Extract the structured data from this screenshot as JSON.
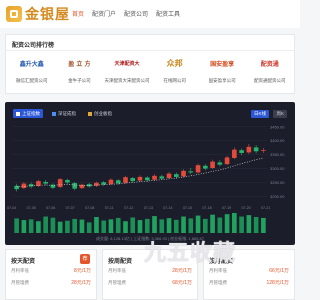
{
  "header": {
    "logo_text": "金银屋",
    "nav": [
      "首页",
      "配资门户",
      "配资公司",
      "配资工具"
    ]
  },
  "section1": {
    "title": "配资公司排行榜",
    "brands": [
      {
        "logo": "鑫升大鑫",
        "name": "融信汇配资公司",
        "color": "#2a5db0"
      },
      {
        "logo": "盈 立 方",
        "name": "金牛子公司",
        "color": "#a0522d"
      },
      {
        "logo": "天津配资大",
        "name": "天津配资大宋配资公司",
        "color": "#b22222"
      },
      {
        "logo": "众邦",
        "name": "在线网公司",
        "color": "#c8871c"
      },
      {
        "logo": "国安盈享",
        "name": "国安盈享公司",
        "color": "#d24a1f"
      },
      {
        "logo": "配资通",
        "name": "配资通配资公司",
        "color": "#d03a2e"
      }
    ]
  },
  "chart": {
    "legend": [
      "上证指数",
      "深证成指",
      "创业板指"
    ],
    "legend_colors": [
      "#2b57d6",
      "#4c8cf5",
      "#e0a63b"
    ],
    "periods": [
      "日K线",
      "周K"
    ],
    "footer": "成交量: 8,128.13亿 | 上证指数: 3,366.93 | 创业板指: 1,869.87",
    "x_labels": [
      "07-04",
      "07-05",
      "07-06",
      "07-07",
      "07-08",
      "07-11",
      "07-12",
      "07-13",
      "07-14",
      "07-15",
      "07-18",
      "07-19",
      "07-20",
      "07-21"
    ],
    "y_labels": [
      "3450.00",
      "3400.00",
      "3350.00",
      "3300.00",
      "3250.00",
      "3200.00"
    ]
  },
  "chart_data": {
    "type": "candlestick",
    "candles": [
      {
        "o": 3238,
        "c": 3226,
        "h": 3245,
        "l": 3218
      },
      {
        "o": 3230,
        "c": 3246,
        "h": 3252,
        "l": 3226
      },
      {
        "o": 3244,
        "c": 3236,
        "h": 3250,
        "l": 3229
      },
      {
        "o": 3238,
        "c": 3255,
        "h": 3260,
        "l": 3234
      },
      {
        "o": 3252,
        "c": 3246,
        "h": 3259,
        "l": 3240
      },
      {
        "o": 3242,
        "c": 3231,
        "h": 3247,
        "l": 3226
      },
      {
        "o": 3234,
        "c": 3262,
        "h": 3266,
        "l": 3230
      },
      {
        "o": 3259,
        "c": 3250,
        "h": 3264,
        "l": 3244
      },
      {
        "o": 3248,
        "c": 3228,
        "h": 3252,
        "l": 3222
      },
      {
        "o": 3230,
        "c": 3242,
        "h": 3246,
        "l": 3226
      },
      {
        "o": 3244,
        "c": 3236,
        "h": 3249,
        "l": 3232
      },
      {
        "o": 3238,
        "c": 3249,
        "h": 3253,
        "l": 3234
      },
      {
        "o": 3251,
        "c": 3243,
        "h": 3255,
        "l": 3238
      },
      {
        "o": 3244,
        "c": 3260,
        "h": 3265,
        "l": 3240
      },
      {
        "o": 3258,
        "c": 3247,
        "h": 3262,
        "l": 3242
      },
      {
        "o": 3249,
        "c": 3269,
        "h": 3274,
        "l": 3245
      },
      {
        "o": 3266,
        "c": 3255,
        "h": 3270,
        "l": 3250
      },
      {
        "o": 3257,
        "c": 3270,
        "h": 3276,
        "l": 3253
      },
      {
        "o": 3268,
        "c": 3258,
        "h": 3272,
        "l": 3252
      },
      {
        "o": 3260,
        "c": 3274,
        "h": 3280,
        "l": 3256
      },
      {
        "o": 3272,
        "c": 3264,
        "h": 3278,
        "l": 3258
      },
      {
        "o": 3266,
        "c": 3282,
        "h": 3288,
        "l": 3262
      },
      {
        "o": 3280,
        "c": 3270,
        "h": 3286,
        "l": 3264
      },
      {
        "o": 3272,
        "c": 3292,
        "h": 3298,
        "l": 3268
      },
      {
        "o": 3290,
        "c": 3286,
        "h": 3302,
        "l": 3280
      },
      {
        "o": 3286,
        "c": 3312,
        "h": 3318,
        "l": 3282
      },
      {
        "o": 3310,
        "c": 3300,
        "h": 3316,
        "l": 3294
      },
      {
        "o": 3302,
        "c": 3325,
        "h": 3332,
        "l": 3298
      },
      {
        "o": 3322,
        "c": 3314,
        "h": 3330,
        "l": 3308
      },
      {
        "o": 3316,
        "c": 3340,
        "h": 3346,
        "l": 3312
      },
      {
        "o": 3338,
        "c": 3368,
        "h": 3376,
        "l": 3334
      },
      {
        "o": 3366,
        "c": 3356,
        "h": 3372,
        "l": 3348
      },
      {
        "o": 3358,
        "c": 3378,
        "h": 3388,
        "l": 3352
      },
      {
        "o": 3376,
        "c": 3362,
        "h": 3384,
        "l": 3354
      },
      {
        "o": 3364,
        "c": 3366,
        "h": 3374,
        "l": 3356
      }
    ],
    "volumes": [
      62,
      55,
      58,
      50,
      70,
      65,
      48,
      52,
      60,
      57,
      45,
      68,
      53,
      58,
      64,
      50,
      66,
      55,
      60,
      72,
      58,
      63,
      56,
      70,
      62,
      74,
      60,
      78,
      66,
      80,
      85,
      70,
      76,
      68,
      64
    ],
    "ma_line": [
      3235,
      3236,
      3238,
      3240,
      3241,
      3240,
      3242,
      3243,
      3241,
      3240,
      3240,
      3241,
      3242,
      3244,
      3245,
      3248,
      3250,
      3253,
      3255,
      3258,
      3260,
      3263,
      3266,
      3270,
      3274,
      3279,
      3284,
      3290,
      3295,
      3302,
      3310,
      3318,
      3325,
      3332,
      3338
    ],
    "ylim": [
      3180,
      3460
    ],
    "grid": true
  },
  "bottom": {
    "cards": [
      {
        "title": "按天配资",
        "sub": "月利率低",
        "val": "8元/1万",
        "sub2": "月管理费",
        "val2": "28元/1万"
      },
      {
        "title": "按周配资",
        "sub": "月利率低",
        "val": "28元/1万",
        "sub2": "月管理费",
        "val2": "68元/1万"
      },
      {
        "title": "按月配资",
        "sub": "月利率低",
        "val": "66元/1万",
        "sub2": "月管理费",
        "val2": "128元/1万"
      }
    ],
    "badge": "荐"
  },
  "watermark": "九五收藏"
}
